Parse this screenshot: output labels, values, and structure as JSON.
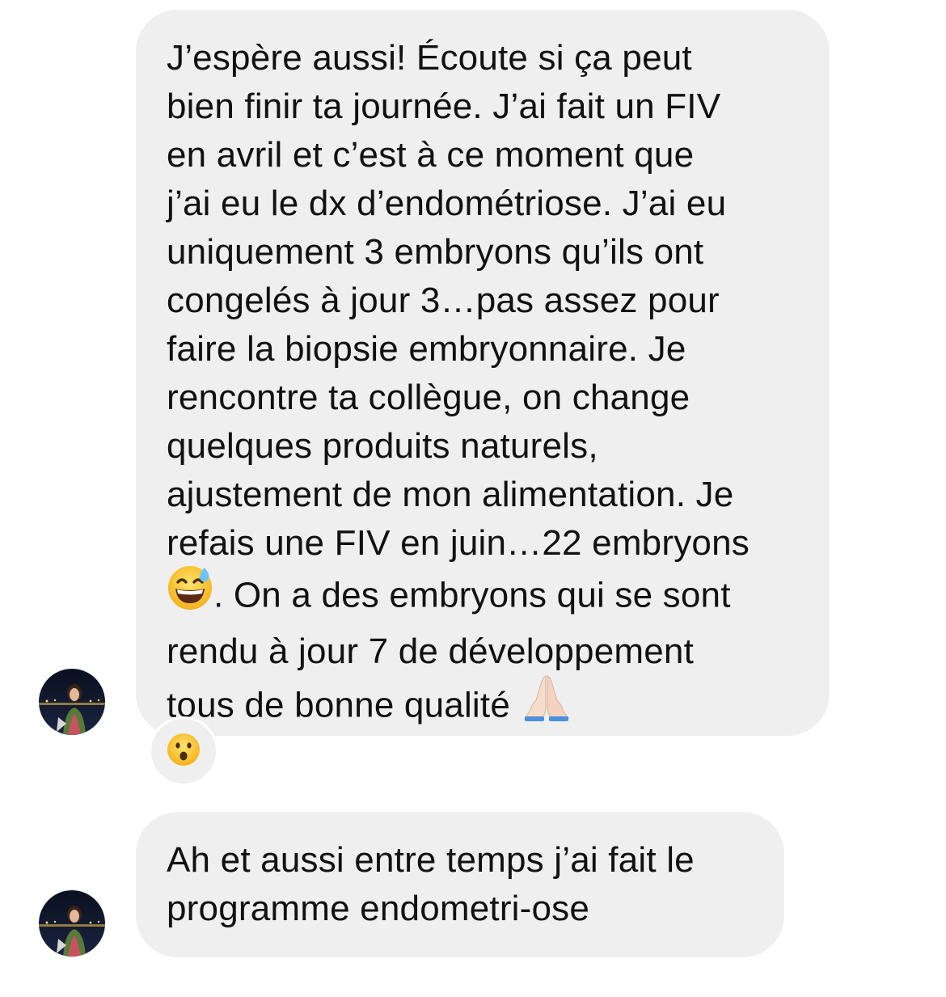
{
  "messages": [
    {
      "sender": "other",
      "lines_part1": [
        "J’espère aussi! Écoute si ça peut",
        "bien finir ta journée. J’ai fait un FIV",
        "en avril et c’est à ce moment que",
        "j’ai eu le dx d’endométriose. J’ai eu",
        "uniquement 3 embryons qu’ils ont",
        "congelés à jour 3…pas assez pour",
        "faire la biopsie embryonnaire. Je",
        "rencontre ta collègue, on change",
        "quelques produits naturels,",
        "ajustement de mon alimentation. Je",
        "refais une FIV en juin…22 embryons"
      ],
      "line_after_emoji": ". On a des embryons qui se sont",
      "line_13": "rendu à jour 7 de développement",
      "line_14": "tous de bonne qualité",
      "emojis": [
        "grinning-sweat-emoji",
        "folded-hands-emoji"
      ],
      "reaction": "surprised-face-emoji"
    },
    {
      "sender": "other",
      "lines": [
        "Ah et aussi entre temps j’ai fait le",
        "programme endometri-ose"
      ]
    }
  ],
  "colors": {
    "bubble": "#efeff0",
    "text": "#111111",
    "background": "#ffffff"
  }
}
